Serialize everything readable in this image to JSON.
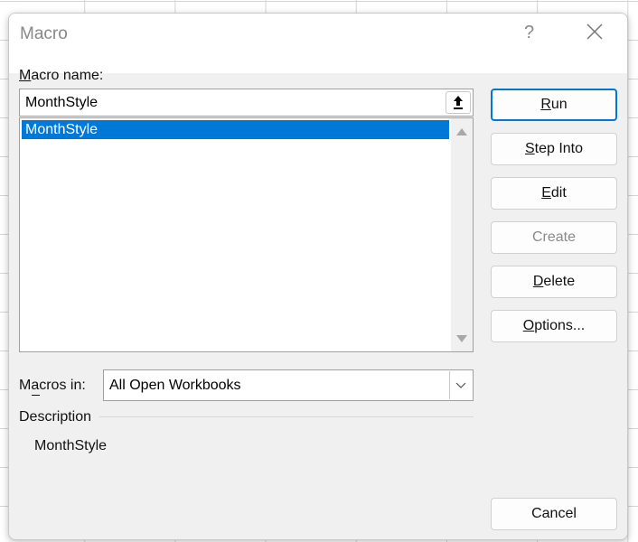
{
  "dialog": {
    "title": "Macro",
    "help_label": "?",
    "macro_name_label": {
      "text": "Macro name:",
      "mnemonic": 0
    },
    "macro_name_value": "MonthStyle",
    "macro_list": [
      "MonthStyle"
    ],
    "macros_in_label": {
      "text": "Macros in:",
      "mnemonic": 1
    },
    "macros_in_value": "All Open Workbooks",
    "description_label": "Description",
    "description_text": "MonthStyle",
    "buttons": {
      "run": {
        "text": "Run",
        "mnemonic": 0
      },
      "step_into": {
        "text": "Step Into",
        "mnemonic": 0
      },
      "edit": {
        "text": "Edit",
        "mnemonic": 0
      },
      "create": {
        "text": "Create",
        "mnemonic": -1
      },
      "delete": {
        "text": "Delete",
        "mnemonic": 0
      },
      "options": {
        "text": "Options...",
        "mnemonic": 0
      },
      "cancel": {
        "text": "Cancel",
        "mnemonic": -1
      }
    },
    "colors": {
      "accent": "#0078d7",
      "selection": "#0078d7"
    }
  }
}
